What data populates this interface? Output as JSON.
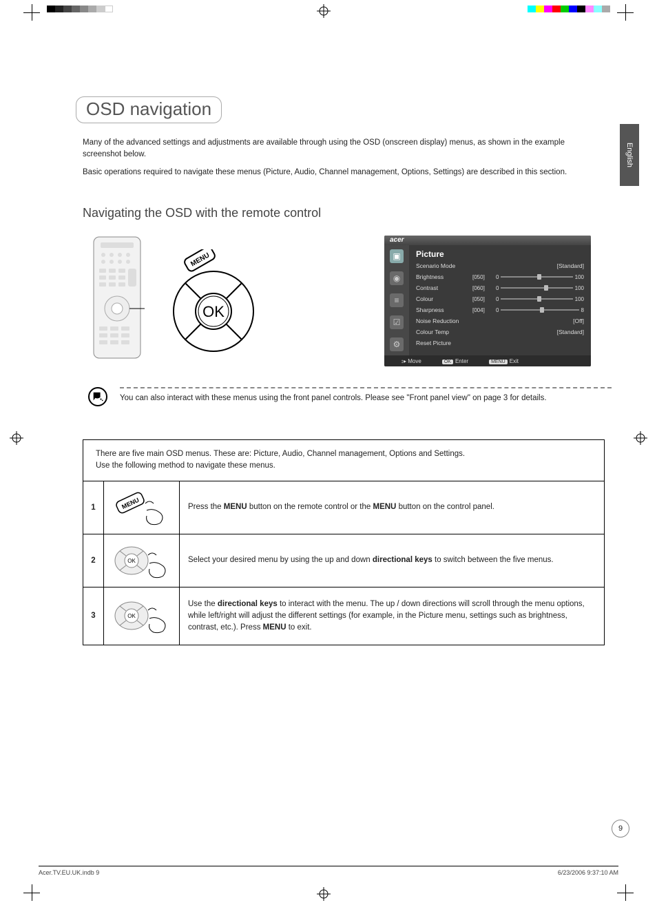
{
  "lang_tab": "English",
  "page_title": "OSD navigation",
  "intro1": "Many of the advanced settings and adjustments are available through using the OSD (onscreen display) menus, as shown in the example screenshot below.",
  "intro2": "Basic operations required to navigate these menus (Picture, Audio, Channel management, Options, Settings) are described in this section.",
  "subheading": "Navigating the OSD with the remote control",
  "nav_wheel": {
    "menu_label": "MENU",
    "ok_label": "OK"
  },
  "osd": {
    "brand": "acer",
    "heading": "Picture",
    "rows": [
      {
        "label": "Scenario Mode",
        "right": "[Standard]"
      },
      {
        "label": "Brightness",
        "val": "[050]",
        "min": "0",
        "max": "100",
        "pct": 50
      },
      {
        "label": "Contrast",
        "val": "[060]",
        "min": "0",
        "max": "100",
        "pct": 60
      },
      {
        "label": "Colour",
        "val": "[050]",
        "min": "0",
        "max": "100",
        "pct": 50
      },
      {
        "label": "Sharpness",
        "val": "[004]",
        "min": "0",
        "max": "8",
        "pct": 50
      },
      {
        "label": "Noise Reduction",
        "right": "[Off]"
      },
      {
        "label": "Colour Temp",
        "right": "[Standard]"
      },
      {
        "label": "Reset Picture"
      }
    ],
    "footer": {
      "move": "Move",
      "enter": "Enter",
      "exit": "Exit",
      "ok_key": "OK",
      "menu_key": "MENU"
    }
  },
  "note": "You can also interact with these menus using the front panel controls. Please see \"Front panel view\" on page 3 for details.",
  "steps_intro1": "There are five main OSD menus. These are: Picture, Audio, Channel management, Options and Settings.",
  "steps_intro2": "Use the following method to navigate these menus.",
  "steps": [
    {
      "n": "1",
      "text_parts": [
        "Press the ",
        "MENU",
        " button on the remote control or the ",
        "MENU",
        " button on the control panel."
      ]
    },
    {
      "n": "2",
      "text_parts": [
        "Select your desired menu by using the up and down ",
        "directional keys",
        " to switch between the five menus."
      ]
    },
    {
      "n": "3",
      "text_parts": [
        "Use the ",
        "directional keys",
        " to interact with the menu. The up / down directions will scroll through the menu options, while left/right will adjust the different settings (for example, in the Picture menu, settings such as brightness, contrast, etc.). Press ",
        "MENU",
        " to exit."
      ]
    }
  ],
  "page_number": "9",
  "footer_left": "Acer.TV.EU.UK.indb   9",
  "footer_right": "6/23/2006   9:37:10 AM"
}
